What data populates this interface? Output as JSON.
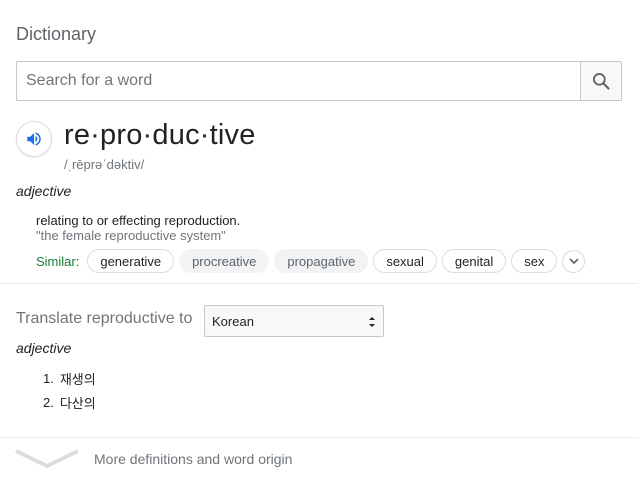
{
  "header": {
    "title": "Dictionary"
  },
  "search": {
    "placeholder": "Search for a word",
    "icon": "search-icon"
  },
  "entry": {
    "word": "re·pro·duc·tive",
    "phonetic": "/ˌrēprəˈdəktiv/",
    "part_of_speech": "adjective",
    "definition": "relating to or effecting reproduction.",
    "example": "\"the female reproductive system\"",
    "similar_label": "Similar:",
    "similar": [
      {
        "label": "generative",
        "style": "outlined"
      },
      {
        "label": "procreative",
        "style": "filled"
      },
      {
        "label": "propagative",
        "style": "filled"
      },
      {
        "label": "sexual",
        "style": "outlined"
      },
      {
        "label": "genital",
        "style": "outlined"
      },
      {
        "label": "sex",
        "style": "outlined"
      }
    ]
  },
  "translate": {
    "label": "Translate reproductive to",
    "selected_language": "Korean",
    "part_of_speech": "adjective",
    "items": [
      {
        "num": "1.",
        "text": "재생의"
      },
      {
        "num": "2.",
        "text": "다산의"
      }
    ]
  },
  "footer": {
    "more_label": "More definitions and word origin"
  },
  "colors": {
    "accent_blue": "#1a73e8",
    "similar_green": "#188038",
    "muted": "#70757a"
  }
}
